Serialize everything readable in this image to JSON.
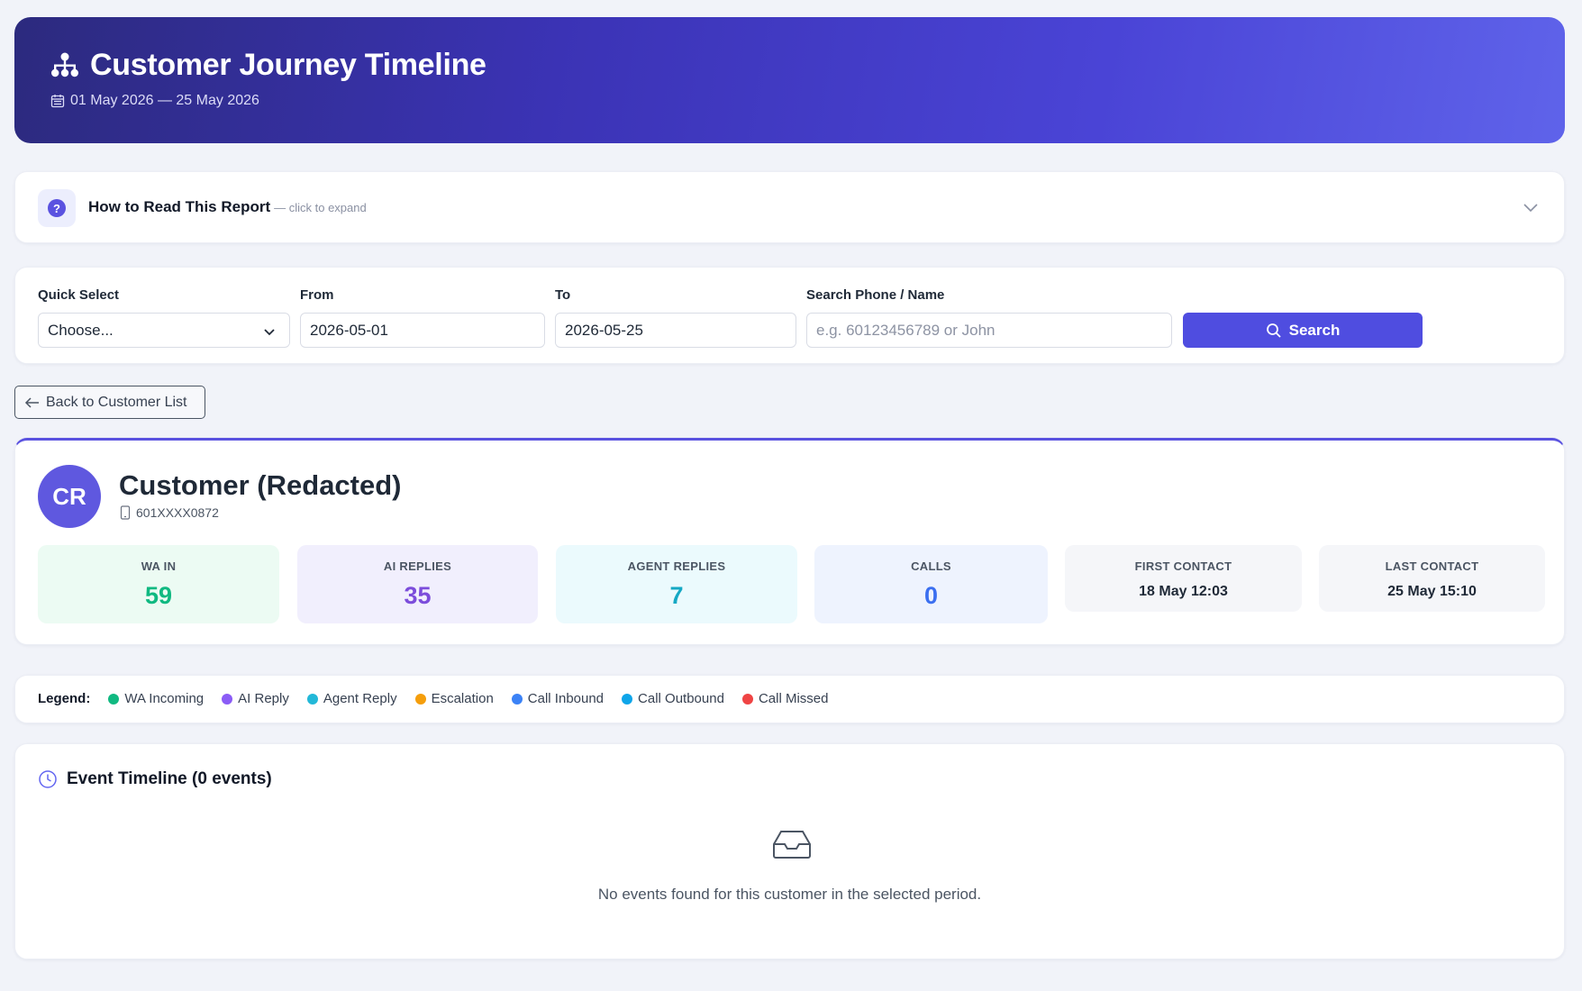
{
  "header": {
    "title": "Customer Journey Timeline",
    "date_range": "01 May 2026 — 25 May 2026",
    "title_icon": "sitemap-icon",
    "date_icon": "calendar-icon"
  },
  "howto": {
    "title": "How to Read This Report",
    "hint": "— click to expand",
    "icon": "question-icon"
  },
  "filters": {
    "quick_select_label": "Quick Select",
    "quick_select_value": "Choose...",
    "from_label": "From",
    "from_value": "2026-05-01",
    "to_label": "To",
    "to_value": "2026-05-25",
    "search_label": "Search Phone / Name",
    "search_placeholder": "e.g. 60123456789 or John",
    "search_button": "Search"
  },
  "back_button": "Back to Customer List",
  "customer": {
    "initials": "CR",
    "name": "Customer (Redacted)",
    "phone": "601XXXX0872",
    "stats": [
      {
        "label": "WA IN",
        "value": "59",
        "color": "#10b981",
        "bg": "#ecfbf3"
      },
      {
        "label": "AI REPLIES",
        "value": "35",
        "color": "#7c4ddb",
        "bg": "#f1effd"
      },
      {
        "label": "AGENT REPLIES",
        "value": "7",
        "color": "#14a8c4",
        "bg": "#ebfafd"
      },
      {
        "label": "CALLS",
        "value": "0",
        "color": "#3b6ff0",
        "bg": "#eef3fe"
      },
      {
        "label": "FIRST CONTACT",
        "value": "18 May 12:03",
        "bg": "#f5f6f9"
      },
      {
        "label": "LAST CONTACT",
        "value": "25 May 15:10",
        "bg": "#f5f6f9"
      }
    ]
  },
  "legend": {
    "title": "Legend:",
    "items": [
      {
        "label": "WA Incoming",
        "color": "#10b981"
      },
      {
        "label": "AI Reply",
        "color": "#8b5cf6"
      },
      {
        "label": "Agent Reply",
        "color": "#22b8d8"
      },
      {
        "label": "Escalation",
        "color": "#f59e0b"
      },
      {
        "label": "Call Inbound",
        "color": "#3b82f6"
      },
      {
        "label": "Call Outbound",
        "color": "#0ea5e9"
      },
      {
        "label": "Call Missed",
        "color": "#ef4444"
      }
    ]
  },
  "timeline": {
    "title": "Event Timeline (0 events)",
    "empty_text": "No events found for this customer in the selected period."
  }
}
